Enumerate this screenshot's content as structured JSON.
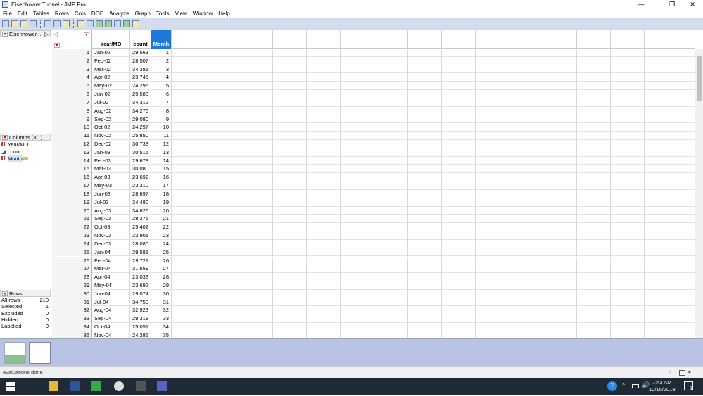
{
  "window": {
    "title": "Eisenhower Tunnel - JMP Pro",
    "minimize": "—",
    "restore": "❐",
    "close": "✕"
  },
  "menu": [
    "File",
    "Edit",
    "Tables",
    "Rows",
    "Cols",
    "DOE",
    "Analyze",
    "Graph",
    "Tools",
    "View",
    "Window",
    "Help"
  ],
  "left_panel": {
    "table_name": "Eisenhower ...",
    "columns_header": "Columns (3/1)",
    "columns": [
      {
        "name": "Year/MO",
        "type": "nominal"
      },
      {
        "name": "count",
        "type": "continuous"
      },
      {
        "name": "Month",
        "type": "nominal",
        "selected": true
      }
    ],
    "rows_header": "Rows",
    "rows_info": [
      {
        "label": "All rows",
        "value": "210"
      },
      {
        "label": "Selected",
        "value": "1"
      },
      {
        "label": "Excluded",
        "value": "0"
      },
      {
        "label": "Hidden",
        "value": "0"
      },
      {
        "label": "Labelled",
        "value": "0"
      }
    ]
  },
  "table": {
    "headers": [
      "Year/MO",
      "count",
      "Month"
    ],
    "selected_column": "Month",
    "rows": [
      [
        "1",
        "Jan-02",
        "29,563",
        "1"
      ],
      [
        "2",
        "Feb-02",
        "28,507",
        "2"
      ],
      [
        "3",
        "Mar-02",
        "34,381",
        "3"
      ],
      [
        "4",
        "Apr-02",
        "23,745",
        "4"
      ],
      [
        "5",
        "May-02",
        "24,295",
        "5"
      ],
      [
        "6",
        "Jun-02",
        "29,583",
        "6"
      ],
      [
        "7",
        "Jul-02",
        "34,312",
        "7"
      ],
      [
        "8",
        "Aug-02",
        "34,276",
        "8"
      ],
      [
        "9",
        "Sep-02",
        "29,080",
        "9"
      ],
      [
        "10",
        "Oct-02",
        "24,297",
        "10"
      ],
      [
        "11",
        "Nov-02",
        "25,850",
        "11"
      ],
      [
        "12",
        "Dec-02",
        "30,733",
        "12"
      ],
      [
        "13",
        "Jan-03",
        "30,515",
        "13"
      ],
      [
        "14",
        "Feb-03",
        "29,678",
        "14"
      ],
      [
        "15",
        "Mar-03",
        "30,080",
        "15"
      ],
      [
        "16",
        "Apr-03",
        "23,692",
        "16"
      ],
      [
        "17",
        "May-03",
        "23,310",
        "17"
      ],
      [
        "18",
        "Jun-03",
        "28,697",
        "18"
      ],
      [
        "19",
        "Jul-03",
        "34,480",
        "19"
      ],
      [
        "20",
        "Aug-03",
        "34,626",
        "20"
      ],
      [
        "21",
        "Sep-03",
        "28,275",
        "21"
      ],
      [
        "22",
        "Oct-03",
        "25,402",
        "22"
      ],
      [
        "23",
        "Nov-03",
        "23,901",
        "23"
      ],
      [
        "24",
        "Dec-03",
        "28,080",
        "24"
      ],
      [
        "25",
        "Jan-04",
        "29,581",
        "25"
      ],
      [
        "26",
        "Feb-04",
        "29,721",
        "26"
      ],
      [
        "27",
        "Mar-04",
        "31,659",
        "27"
      ],
      [
        "28",
        "Apr-04",
        "23,033",
        "28"
      ],
      [
        "29",
        "May-04",
        "23,692",
        "29"
      ],
      [
        "30",
        "Jun-04",
        "29,074",
        "30"
      ],
      [
        "31",
        "Jul-04",
        "34,750",
        "31"
      ],
      [
        "32",
        "Aug-04",
        "32,923",
        "32"
      ],
      [
        "33",
        "Sep-04",
        "29,318",
        "33"
      ],
      [
        "34",
        "Oct-04",
        "25,051",
        "34"
      ],
      [
        "35",
        "Nov-04",
        "24,285",
        "35"
      ]
    ]
  },
  "status": {
    "text": "evaluations done"
  },
  "taskbar": {
    "time": "7:42 AM",
    "date": "10/15/2019",
    "notifications": "1"
  },
  "colors": {
    "selected_header": "#1e7ad8",
    "toolbar": "#d5dcee",
    "thumb_strip": "#b9c3e3",
    "taskbar": "#1f2a36"
  }
}
